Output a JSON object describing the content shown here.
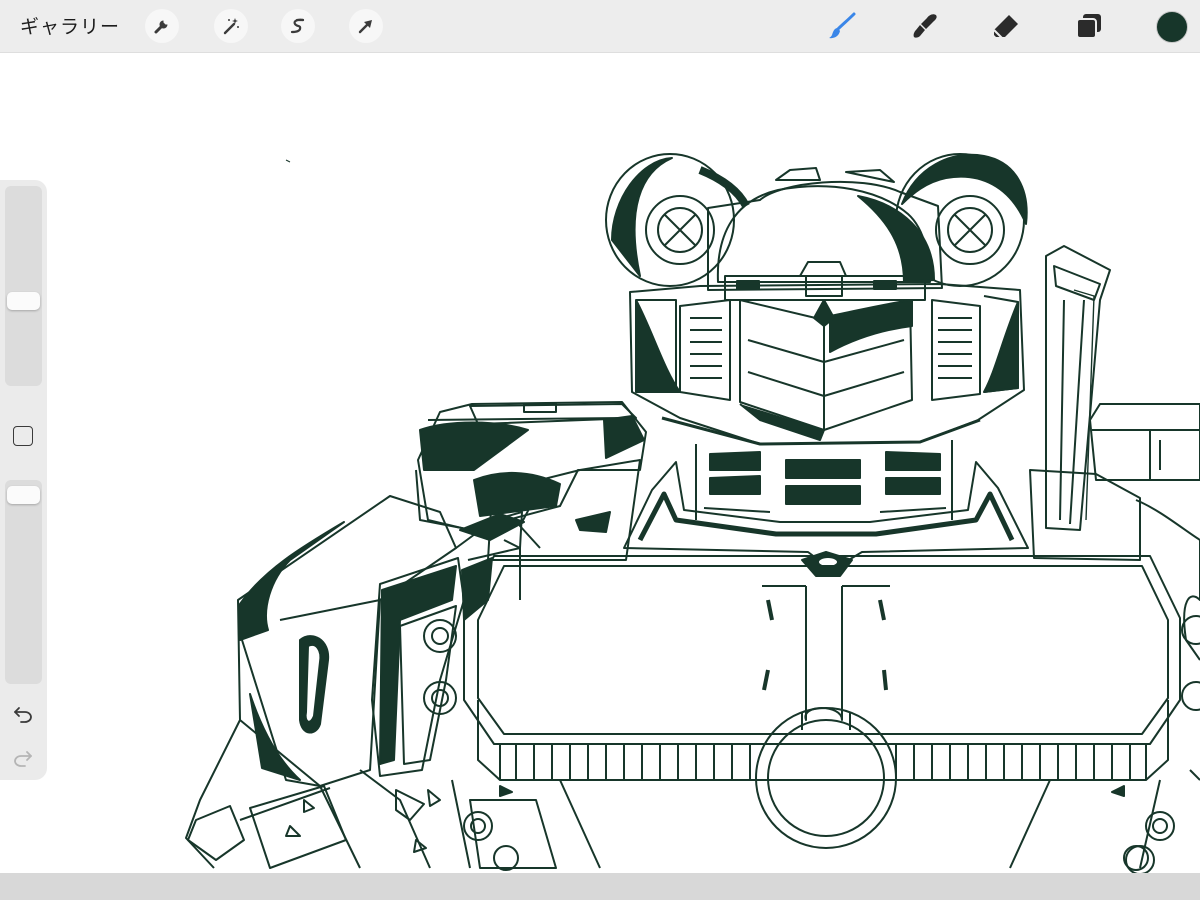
{
  "toolbar": {
    "gallery_label": "ギャラリー",
    "left_tools": [
      "wrench-icon",
      "magic-wand-icon",
      "selection-icon",
      "transform-arrow-icon"
    ],
    "right_tools": [
      "brush-icon",
      "smudge-icon",
      "eraser-icon",
      "layers-icon"
    ],
    "active_tool": "brush",
    "active_tool_color": "#3a86e8",
    "current_color": "#17362a"
  },
  "sidebar": {
    "brush_size_fraction": 0.42,
    "brush_opacity_fraction": 0.97,
    "modify_button_icon": "square-icon",
    "undo_icon": "undo-icon",
    "redo_icon": "redo-icon"
  },
  "canvas": {
    "background": "#ffffff",
    "ink_color": "#17362a"
  }
}
